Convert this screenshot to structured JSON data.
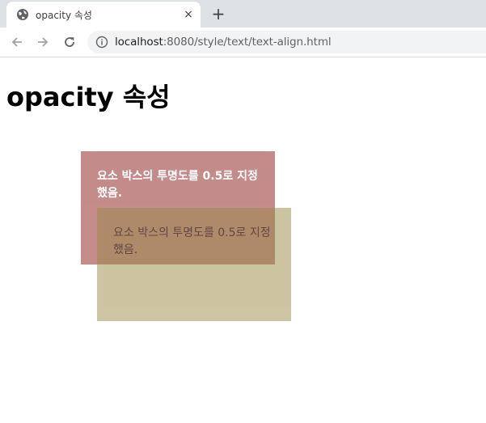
{
  "browser": {
    "tab": {
      "title": "opacity 속성",
      "favicon": "globe-icon",
      "close_label": "×"
    },
    "new_tab_label": "+",
    "nav": {
      "back_icon": "arrow-left-icon",
      "forward_icon": "arrow-right-icon",
      "reload_icon": "reload-icon"
    },
    "address": {
      "host": "localhost",
      "rest": ":8080/style/text/text-align.html",
      "security_icon": "info-icon"
    }
  },
  "page": {
    "heading": "opacity 속성",
    "boxes": [
      {
        "text": "요소 박스의 투명도를 0.5로 지정했음.",
        "background": "#8b1a1a",
        "text_color": "#ffffff",
        "opacity": 0.5
      },
      {
        "text": "요소 박스의 투명도를 0.5로 지정했음.",
        "background": "#9a8a45",
        "text_color": "#000000",
        "opacity": 0.5
      }
    ]
  },
  "colors": {
    "tabstrip": "#dee1e6",
    "omnibox": "#f1f3f4"
  }
}
